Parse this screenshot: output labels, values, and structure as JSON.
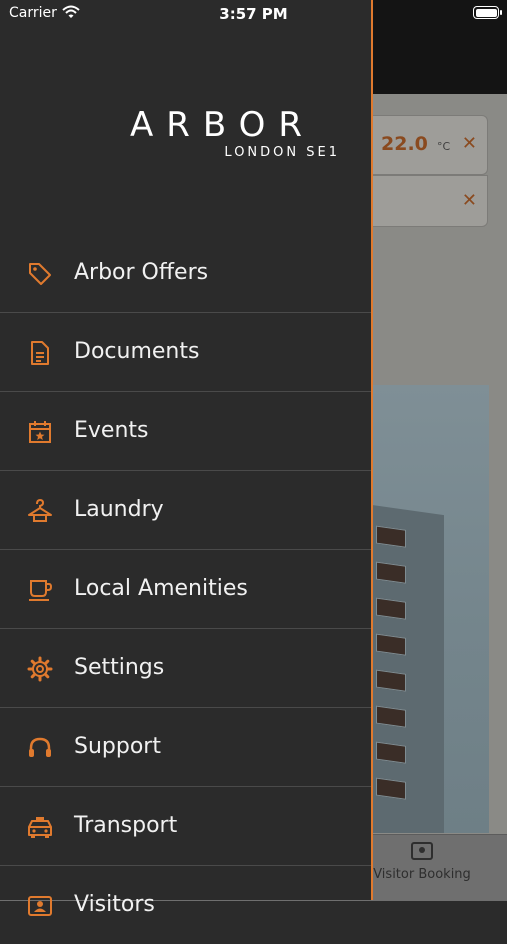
{
  "status_bar": {
    "carrier": "Carrier",
    "time": "3:57 PM"
  },
  "brand": {
    "name": "ARBOR",
    "subtitle": "LONDON SE1"
  },
  "menu": {
    "items": [
      {
        "label": "Arbor Offers",
        "icon": "tag-icon"
      },
      {
        "label": "Documents",
        "icon": "document-icon"
      },
      {
        "label": "Events",
        "icon": "calendar-star-icon"
      },
      {
        "label": "Laundry",
        "icon": "hanger-icon"
      },
      {
        "label": "Local Amenities",
        "icon": "coffee-cup-icon"
      },
      {
        "label": "Settings",
        "icon": "gear-icon"
      },
      {
        "label": "Support",
        "icon": "headset-icon"
      },
      {
        "label": "Transport",
        "icon": "taxi-icon"
      },
      {
        "label": "Visitors",
        "icon": "visitor-card-icon"
      }
    ]
  },
  "background": {
    "temperature": {
      "value": "22.0",
      "unit": "°C"
    },
    "close_symbol": "✕",
    "tabbar": {
      "visitor_booking_label": "Visitor Booking"
    }
  },
  "colors": {
    "accent": "#e07a2e",
    "drawer_bg": "#2b2b2b",
    "divider": "#4a4a4a"
  }
}
